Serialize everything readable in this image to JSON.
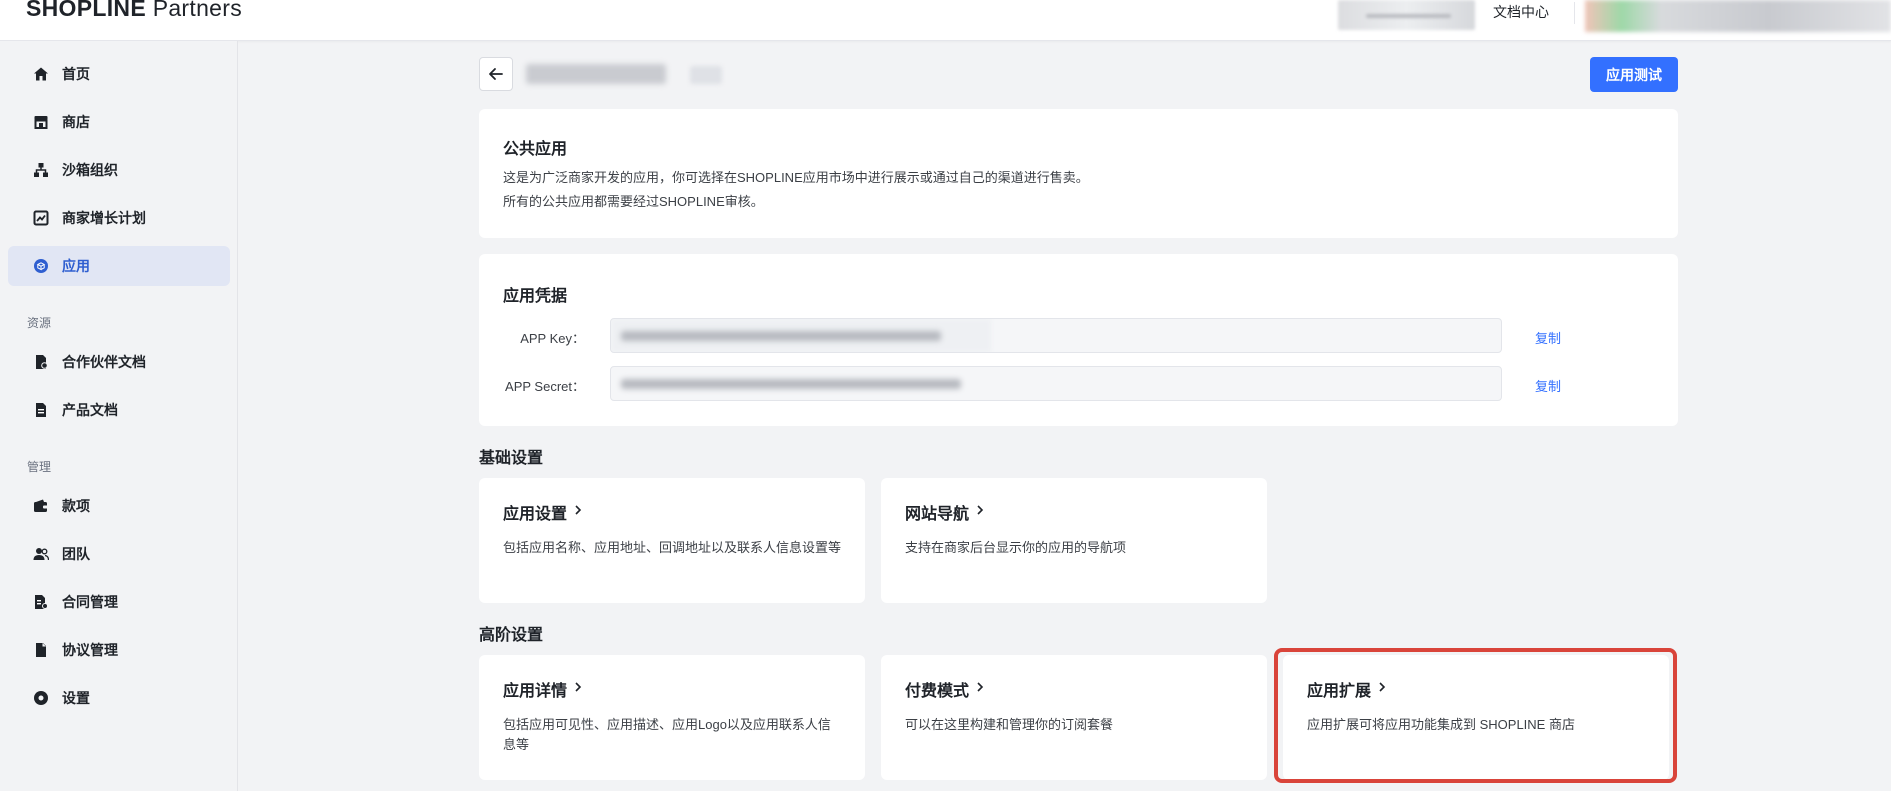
{
  "header": {
    "logo_brand": "SHOPLINE",
    "logo_sub": "Partners",
    "doc_center": "文档中心"
  },
  "sidebar": {
    "items_top": [
      {
        "label": "首页",
        "icon": "home-icon"
      },
      {
        "label": "商店",
        "icon": "store-icon"
      },
      {
        "label": "沙箱组织",
        "icon": "sandbox-icon"
      },
      {
        "label": "商家增长计划",
        "icon": "growth-chart-icon"
      },
      {
        "label": "应用",
        "icon": "app-icon",
        "active": true
      }
    ],
    "section_resources": "资源",
    "items_resources": [
      {
        "label": "合作伙伴文档",
        "icon": "partner-doc-icon"
      },
      {
        "label": "产品文档",
        "icon": "product-doc-icon"
      }
    ],
    "section_manage": "管理",
    "items_manage": [
      {
        "label": "款项",
        "icon": "wallet-icon"
      },
      {
        "label": "团队",
        "icon": "team-icon"
      },
      {
        "label": "合同管理",
        "icon": "contract-icon"
      },
      {
        "label": "协议管理",
        "icon": "agreement-icon"
      },
      {
        "label": "设置",
        "icon": "settings-icon"
      }
    ]
  },
  "toolbar": {
    "test_button": "应用测试"
  },
  "public_app": {
    "title": "公共应用",
    "line1": "这是为广泛商家开发的应用，你可选择在SHOPLINE应用市场中进行展示或通过自己的渠道进行售卖。",
    "line2": "所有的公共应用都需要经过SHOPLINE审核。"
  },
  "credentials": {
    "title": "应用凭据",
    "key_label": "APP Key：",
    "secret_label": "APP Secret：",
    "copy": "复制"
  },
  "basic": {
    "heading": "基础设置",
    "cards": [
      {
        "title": "应用设置",
        "desc": "包括应用名称、应用地址、回调地址以及联系人信息设置等"
      },
      {
        "title": "网站导航",
        "desc": "支持在商家后台显示你的应用的导航项"
      }
    ]
  },
  "advanced": {
    "heading": "高阶设置",
    "cards": [
      {
        "title": "应用详情",
        "desc": "包括应用可见性、应用描述、应用Logo以及应用联系人信息等"
      },
      {
        "title": "付费模式",
        "desc": "可以在这里构建和管理你的订阅套餐"
      },
      {
        "title": "应用扩展",
        "desc": "应用扩展可将应用功能集成到 SHOPLINE 商店"
      }
    ]
  },
  "colors": {
    "accent": "#3370ff",
    "active_bg": "#e1e6f4",
    "highlight": "#d9443a"
  }
}
